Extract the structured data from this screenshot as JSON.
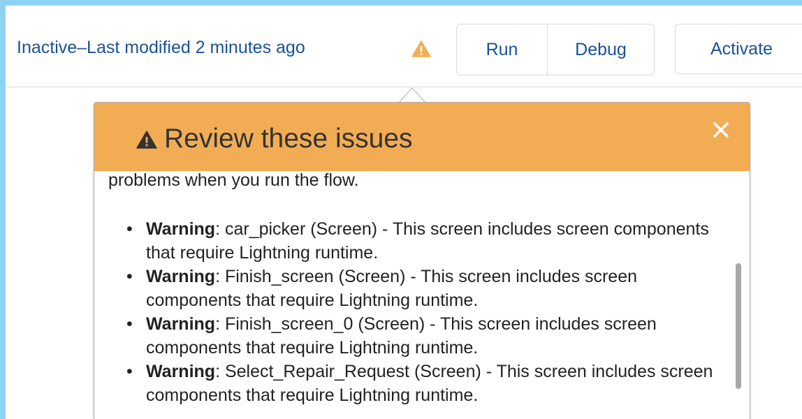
{
  "toolbar": {
    "status": "Inactive–Last modified 2 minutes ago",
    "run_label": "Run",
    "debug_label": "Debug",
    "activate_label": "Activate",
    "warning_icon": "warning-triangle-icon",
    "warning_color": "#f2ad54"
  },
  "popover": {
    "title": "Review these issues",
    "header_color": "#f2ad54",
    "close_icon": "close-icon",
    "intro_text": "problems when you run the flow.",
    "issues": [
      {
        "label": "Warning",
        "text": ": car_picker (Screen) - This screen includes screen components that require Lightning runtime."
      },
      {
        "label": "Warning",
        "text": ": Finish_screen (Screen) - This screen includes screen components that require Lightning runtime."
      },
      {
        "label": "Warning",
        "text": ": Finish_screen_0 (Screen) - This screen includes screen components that require Lightning runtime."
      },
      {
        "label": "Warning",
        "text": ": Select_Repair_Request (Screen) - This screen includes screen components that require Lightning runtime."
      }
    ]
  }
}
